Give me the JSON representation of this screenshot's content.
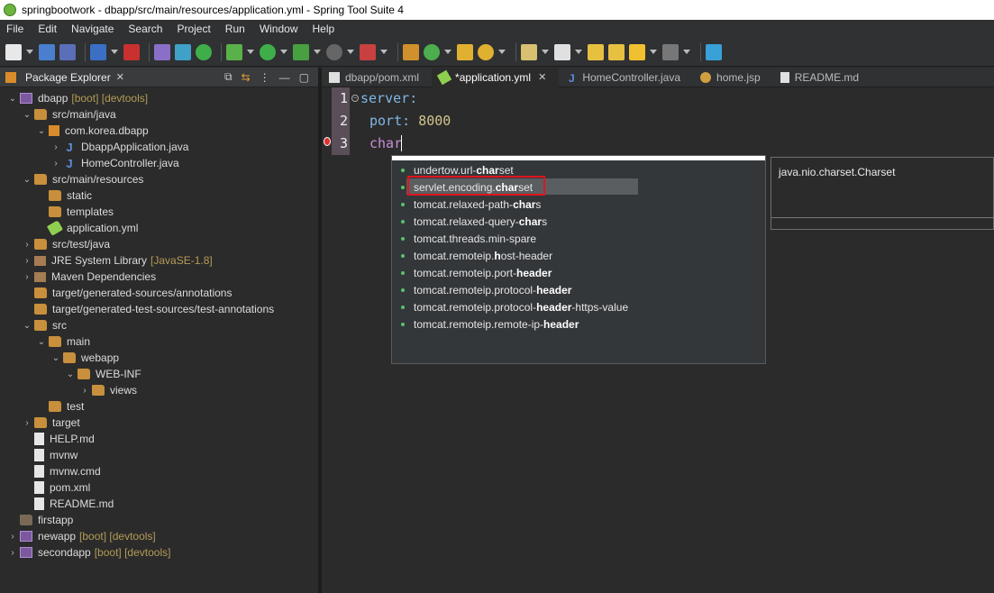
{
  "window": {
    "title": "springbootwork - dbapp/src/main/resources/application.yml - Spring Tool Suite 4"
  },
  "menu": [
    "File",
    "Edit",
    "Navigate",
    "Search",
    "Project",
    "Run",
    "Window",
    "Help"
  ],
  "package_explorer": {
    "title": "Package Explorer",
    "close": "✕",
    "tree": [
      {
        "label": "dbapp",
        "deco": "[boot] [devtools]",
        "kind": "project",
        "depth": 0,
        "expanded": true
      },
      {
        "label": "src/main/java",
        "kind": "srcfolder",
        "depth": 1,
        "expanded": true
      },
      {
        "label": "com.korea.dbapp",
        "kind": "package",
        "depth": 2,
        "expanded": true
      },
      {
        "label": "DbappApplication.java",
        "kind": "java",
        "depth": 3,
        "expanded": false
      },
      {
        "label": "HomeController.java",
        "kind": "java",
        "depth": 3,
        "expanded": false
      },
      {
        "label": "src/main/resources",
        "kind": "srcfolder",
        "depth": 1,
        "expanded": true
      },
      {
        "label": "static",
        "kind": "folder",
        "depth": 2
      },
      {
        "label": "templates",
        "kind": "folder",
        "depth": 2
      },
      {
        "label": "application.yml",
        "kind": "yml",
        "depth": 2
      },
      {
        "label": "src/test/java",
        "kind": "srcfolder",
        "depth": 1,
        "expanded": false
      },
      {
        "label": "JRE System Library",
        "deco": "[JavaSE-1.8]",
        "kind": "library",
        "depth": 1,
        "expanded": false
      },
      {
        "label": "Maven Dependencies",
        "kind": "library",
        "depth": 1,
        "expanded": false
      },
      {
        "label": "target/generated-sources/annotations",
        "kind": "srcfolder",
        "depth": 1
      },
      {
        "label": "target/generated-test-sources/test-annotations",
        "kind": "srcfolder",
        "depth": 1
      },
      {
        "label": "src",
        "kind": "folder",
        "depth": 1,
        "expanded": true
      },
      {
        "label": "main",
        "kind": "folder",
        "depth": 2,
        "expanded": true
      },
      {
        "label": "webapp",
        "kind": "folder",
        "depth": 3,
        "expanded": true
      },
      {
        "label": "WEB-INF",
        "kind": "folder",
        "depth": 4,
        "expanded": true
      },
      {
        "label": "views",
        "kind": "folder",
        "depth": 5,
        "expanded": false
      },
      {
        "label": "test",
        "kind": "folder",
        "depth": 2
      },
      {
        "label": "target",
        "kind": "folder",
        "depth": 1,
        "expanded": false
      },
      {
        "label": "HELP.md",
        "kind": "file",
        "depth": 1
      },
      {
        "label": "mvnw",
        "kind": "file",
        "depth": 1
      },
      {
        "label": "mvnw.cmd",
        "kind": "file",
        "depth": 1
      },
      {
        "label": "pom.xml",
        "kind": "file",
        "depth": 1
      },
      {
        "label": "README.md",
        "kind": "file",
        "depth": 1
      },
      {
        "label": "firstapp",
        "kind": "closedproject",
        "depth": 0
      },
      {
        "label": "newapp",
        "deco": "[boot] [devtools]",
        "kind": "project",
        "depth": 0,
        "expanded": false
      },
      {
        "label": "secondapp",
        "deco": "[boot] [devtools]",
        "kind": "project",
        "depth": 0,
        "expanded": false
      }
    ]
  },
  "editor_tabs": [
    {
      "label": "dbapp/pom.xml",
      "icon": "xml-file-icon",
      "active": false
    },
    {
      "label": "*application.yml",
      "icon": "yaml-file-icon",
      "active": true,
      "close": "✕"
    },
    {
      "label": "HomeController.java",
      "icon": "java-file-icon",
      "active": false
    },
    {
      "label": "home.jsp",
      "icon": "jsp-file-icon",
      "active": false
    },
    {
      "label": "README.md",
      "icon": "md-file-icon",
      "active": false
    }
  ],
  "code_lines": [
    {
      "num": "1",
      "key": "server",
      "sep": ":",
      "value": ""
    },
    {
      "num": "2",
      "key": "port",
      "sep": ": ",
      "value": "8000"
    },
    {
      "num": "3",
      "key": "",
      "sep": "",
      "value": "char"
    }
  ],
  "autocomplete": {
    "items": [
      {
        "pre": "undertow.url-",
        "bold": "char",
        "post": "set"
      },
      {
        "pre": "servlet.encoding.",
        "bold": "char",
        "post": "set",
        "selected": true
      },
      {
        "pre": "tomcat.relaxed-path-",
        "bold": "char",
        "post": "s"
      },
      {
        "pre": "tomcat.relaxed-query-",
        "bold": "char",
        "post": "s"
      },
      {
        "pre": "tomcat.threads.min-spare",
        "bold": "",
        "post": ""
      },
      {
        "pre": "tomcat.remoteip.",
        "bold": "h",
        "post": "ost-header"
      },
      {
        "pre": "tomcat.remoteip.port-",
        "bold": "header",
        "post": ""
      },
      {
        "pre": "tomcat.remoteip.protocol-",
        "bold": "header",
        "post": ""
      },
      {
        "pre": "tomcat.remoteip.protocol-",
        "bold": "header",
        "post": "-https-value"
      },
      {
        "pre": "tomcat.remoteip.remote-ip-",
        "bold": "header",
        "post": ""
      }
    ],
    "doc": "java.nio.charset.Charset"
  }
}
